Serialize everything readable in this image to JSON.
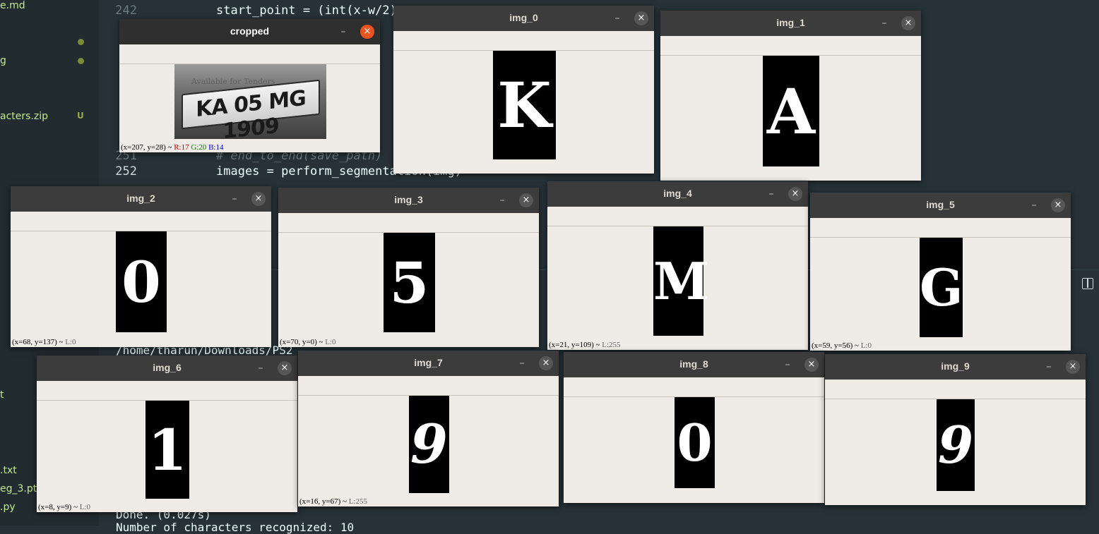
{
  "editor": {
    "sidebar_files": [
      {
        "name": "e.md",
        "badge": ""
      },
      {
        "name": "g",
        "badge": ""
      },
      {
        "name": "acters.zip",
        "badge": "U"
      },
      {
        "name": "t",
        "badge": ""
      },
      {
        "name": ".txt",
        "badge": ""
      },
      {
        "name": "eg_3.pt",
        "badge": ""
      },
      {
        "name": ".py",
        "badge": ""
      }
    ],
    "line_numbers": [
      "242",
      "251",
      "252"
    ],
    "code_lines": [
      "start_point = (int(x-w/2)",
      "# end_to_end(save_path)",
      "images = perform_segmentation(img)"
    ],
    "terminal_lines": [
      "/home/tharun/Downloads/PS2",
      "Done. (0.027s)",
      "Number of characters recognized: 10"
    ]
  },
  "windows": {
    "cropped": {
      "title": "cropped",
      "min": "–",
      "close": "×",
      "plate_text": "KA 05 MG 1909",
      "watermark": "Available for Tenders",
      "status": {
        "coords": "(x=207, y=28) ~",
        "r": "R:17",
        "g": "G:20",
        "b": "B:14"
      }
    },
    "img_0": {
      "title": "img_0",
      "min": "–",
      "close": "×",
      "char": "K",
      "status": ""
    },
    "img_1": {
      "title": "img_1",
      "min": "–",
      "close": "×",
      "char": "A",
      "status": ""
    },
    "img_2": {
      "title": "img_2",
      "min": "–",
      "close": "×",
      "char": "0",
      "status": "(x=68, y=137) ~",
      "level": "L:0"
    },
    "img_3": {
      "title": "img_3",
      "min": "–",
      "close": "×",
      "char": "5",
      "status": "(x=70, y=0) ~",
      "level": "L:0"
    },
    "img_4": {
      "title": "img_4",
      "min": "–",
      "close": "×",
      "char": "M",
      "status": "(x=21, y=109) ~",
      "level": "L:255"
    },
    "img_5": {
      "title": "img_5",
      "min": "–",
      "close": "×",
      "char": "G",
      "status": "(x=59, y=56) ~",
      "level": "L:0"
    },
    "img_6": {
      "title": "img_6",
      "min": "–",
      "close": "×",
      "char": "1",
      "status": "(x=8, y=9) ~",
      "level": "L:0"
    },
    "img_7": {
      "title": "img_7",
      "min": "–",
      "close": "×",
      "char": "9",
      "status": "(x=16, y=67) ~",
      "level": "L:255"
    },
    "img_8": {
      "title": "img_8",
      "min": "–",
      "close": "×",
      "char": "0",
      "status": ""
    },
    "img_9": {
      "title": "img_9",
      "min": "–",
      "close": "×",
      "char": "9",
      "status": ""
    }
  },
  "colors": {
    "active_close": "#e95420",
    "window_bg": "#efebe6",
    "titlebar": "#3c3c3c"
  }
}
